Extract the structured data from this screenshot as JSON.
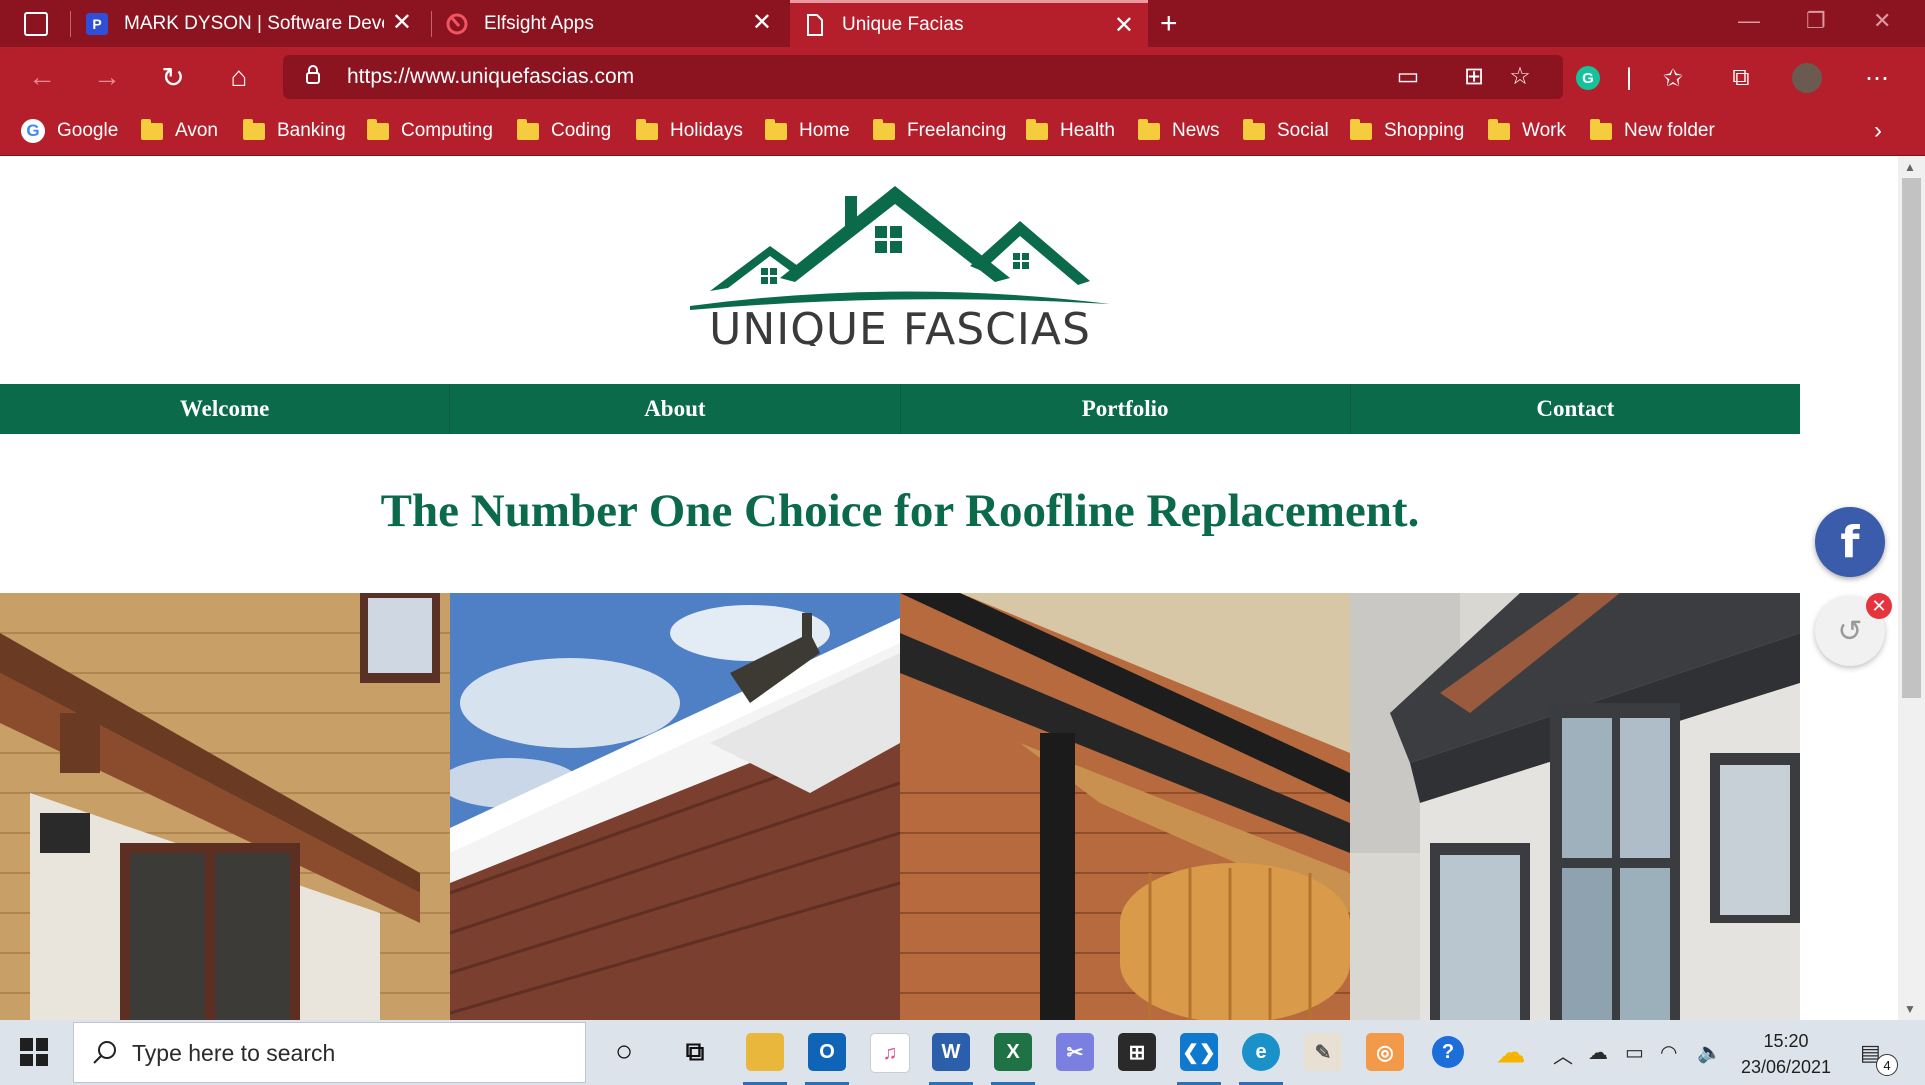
{
  "browser": {
    "tabs": [
      {
        "label": "MARK DYSON | Software Develo",
        "favicon": "P"
      },
      {
        "label": "Elfsight Apps"
      },
      {
        "label": "Unique Facias"
      }
    ],
    "url": "https://www.uniquefascias.com",
    "bookmarks": [
      "Google",
      "Avon",
      "Banking",
      "Computing",
      "Coding",
      "Holidays",
      "Home",
      "Freelancing",
      "Health",
      "News",
      "Social",
      "Shopping",
      "Work",
      "New folder"
    ],
    "colors": {
      "frame": "#8b1420",
      "toolbar": "#b51f2b",
      "folder": "#f4cc3e"
    }
  },
  "page": {
    "logo": {
      "text": "UNIQUE FASCIAS",
      "color": "#0a6a4a"
    },
    "nav": [
      "Welcome",
      "About",
      "Portfolio",
      "Contact"
    ],
    "headline": "The Number One Choice for Roofline Replacement.",
    "photos": [
      "brown-fascia-house",
      "white-gutter-sky",
      "black-downpipe-garage",
      "anthracite-fascia-house"
    ],
    "social": {
      "facebook_icon": "f",
      "history_icon": "history-icon"
    },
    "accent": "#0a6a4a"
  },
  "taskbar": {
    "search_placeholder": "Type here to search",
    "time": "15:20",
    "date": "23/06/2021",
    "notifications": "4",
    "apps": [
      "cortana",
      "task-view",
      "file-explorer",
      "outlook",
      "itunes",
      "word",
      "excel",
      "snipping",
      "store",
      "vscode",
      "edge",
      "paint",
      "app-orange",
      "help",
      "weather"
    ]
  }
}
